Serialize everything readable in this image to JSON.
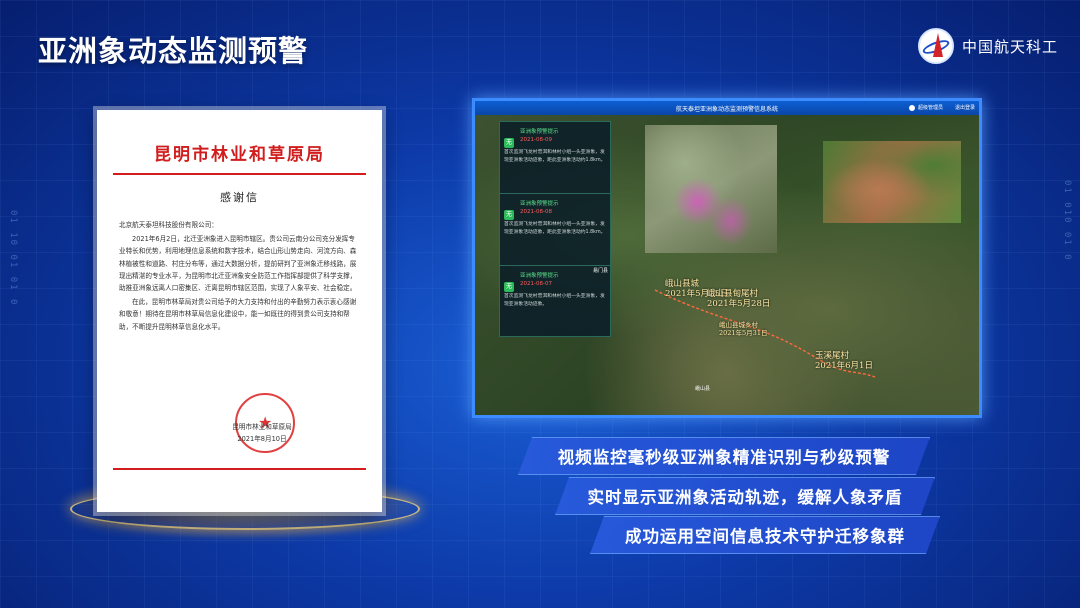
{
  "header": {
    "title": "亚洲象动态监测预警",
    "brand_name": "中国航天科工"
  },
  "side_numbers": {
    "left": "01 10 01 01 0",
    "right": "01 010 01 0"
  },
  "letter": {
    "org_name": "昆明市林业和草原局",
    "doc_title": "感谢信",
    "recipient": "北京航天泰坦科技股份有限公司：",
    "paragraphs": [
      "2021年6月2日，北迁亚洲象进入昆明市辖区。贵公司云南分公司充分发挥专业特长和优势，利用地理信息系统和数字技术，结合山形山势走向、河流方向、森林植被性和道路、村庄分布等，通过大数据分析，提前研判了亚洲象迁移线路，展现出精湛的专业水平，为昆明市北迁亚洲象安全防范工作指挥部提供了科学支撑，助推亚洲象远离人口密集区、迁离昆明市辖区范围，实现了人象平安、社会稳定。",
      "在此，昆明市林草局对贵公司给予的大力支持和付出的辛勤努力表示衷心感谢和敬意！期待在昆明市林草局信息化建设中，能一如既往的得到贵公司支持和帮助，不断提升昆明林草信息化水平。"
    ],
    "seal_text": "市林业和草",
    "signature": "昆明市林业和草原局",
    "date": "2021年8月10日"
  },
  "system": {
    "window_title": "航天泰坦亚洲象动态监测预警信息系统",
    "user_label": "超级管理员",
    "logout_label": "退出登录",
    "alerts": [
      {
        "badge": "无",
        "title": "亚洲象预警提示",
        "date": "2021-08-09",
        "text": "首次监测飞龙村普洱和林村小组一头亚洲象，发现亚洲象活动迹象，距此亚洲象活动约1.8km。"
      },
      {
        "badge": "无",
        "title": "亚洲象预警提示",
        "date": "2021-08-08",
        "text": "首次监测飞龙村普洱和林村小组一头亚洲象，发现亚洲象活动迹象，距此亚洲象活动约1.8km。"
      },
      {
        "badge": "无",
        "title": "亚洲象预警提示",
        "date": "2021-08-07",
        "text": "首次监测飞龙村普洱和林村小组一头亚洲象，发现亚洲象活动迹象。"
      }
    ],
    "map_labels": [
      {
        "name": "峨山县城",
        "date": "2021年5月25日"
      },
      {
        "name": "峨山县甸尾村",
        "date": "2021年5月28日"
      },
      {
        "name": "峨山县城乡村",
        "date": "2021年5月31日"
      },
      {
        "name": "玉溪尾村",
        "date": "2021年6月1日"
      }
    ],
    "small_labels": [
      "易门县",
      "峨山县"
    ]
  },
  "features": [
    "视频监控毫秒级亚洲象精准识别与秒级预警",
    "实时显示亚洲象活动轨迹，缓解人象矛盾",
    "成功运用空间信息技术守护迁移象群"
  ]
}
